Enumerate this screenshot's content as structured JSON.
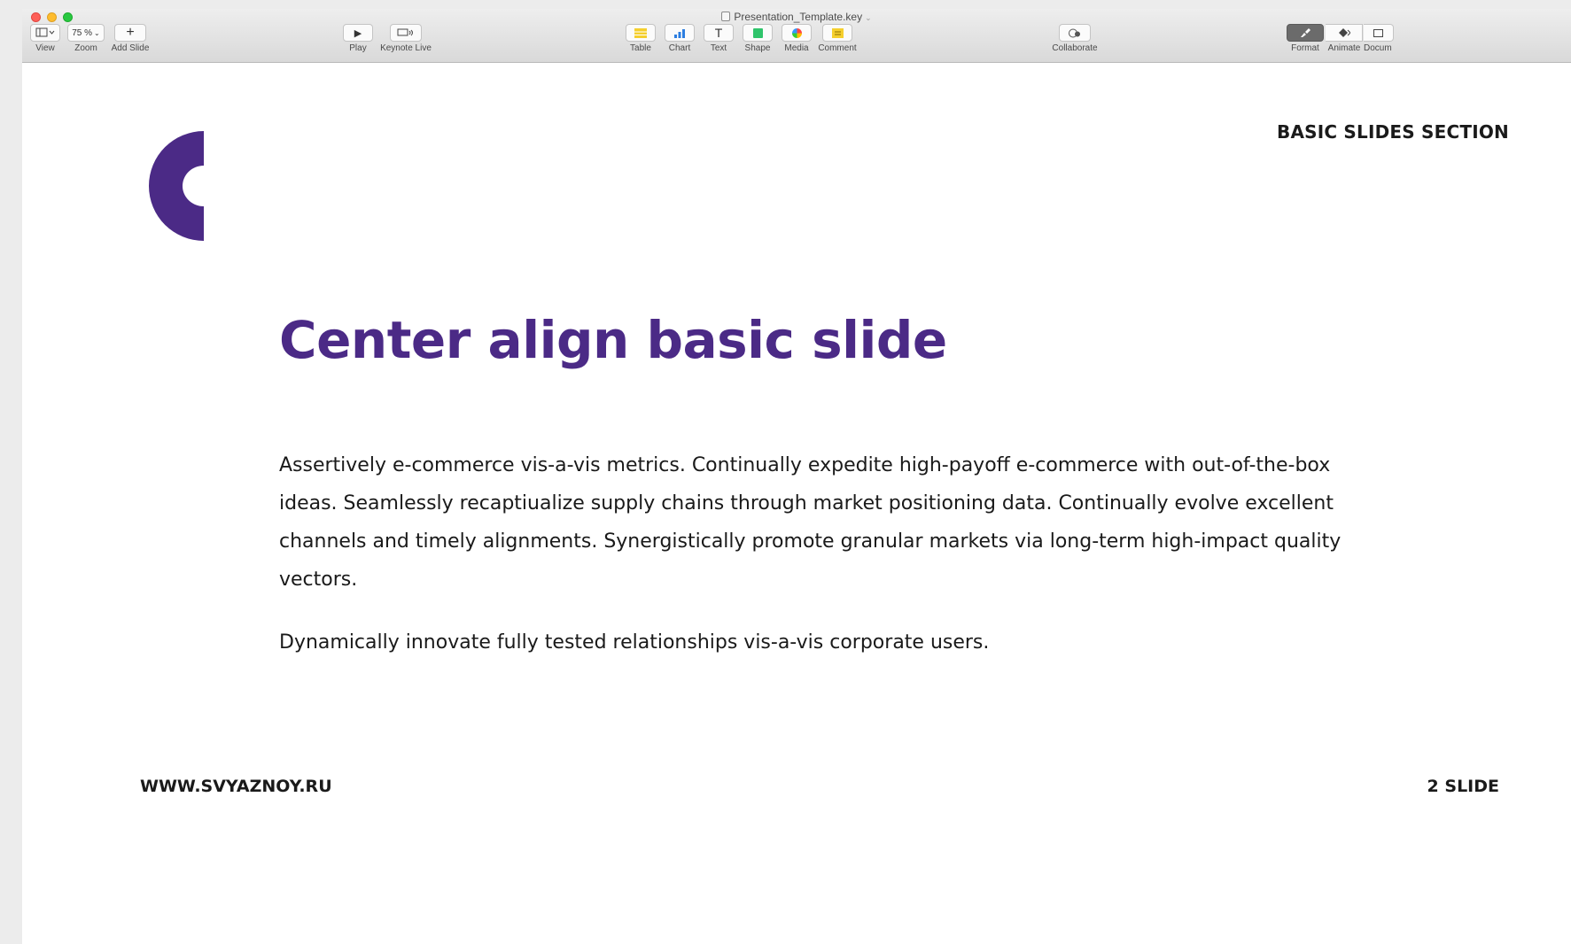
{
  "window": {
    "title": "Presentation_Template.key"
  },
  "toolbar": {
    "view": {
      "label": "View"
    },
    "zoom": {
      "label": "Zoom",
      "value": "75 %"
    },
    "add_slide": {
      "label": "Add Slide"
    },
    "play": {
      "label": "Play"
    },
    "keynote_live": {
      "label": "Keynote Live"
    },
    "table": {
      "label": "Table"
    },
    "chart": {
      "label": "Chart"
    },
    "text": {
      "label": "Text"
    },
    "shape": {
      "label": "Shape"
    },
    "media": {
      "label": "Media"
    },
    "comment": {
      "label": "Comment"
    },
    "collaborate": {
      "label": "Collaborate"
    },
    "format": {
      "label": "Format"
    },
    "animate": {
      "label": "Animate"
    },
    "document": {
      "label": "Docum"
    }
  },
  "slide": {
    "section_label": "BASIC SLIDES SECTION",
    "title": "Center align basic slide",
    "paragraphs": [
      "Assertively e-commerce vis-a-vis metrics. Continually expedite high-payoff e-commerce with out-of-the-box ideas. Seamlessly recaptiualize supply chains through market positioning data. Continually evolve excellent channels and timely alignments. Synergistically promote granular markets via long-term high-impact quality vectors.",
      "Dynamically innovate fully tested relationships vis-a-vis corporate users."
    ],
    "footer_left": "WWW.SVYAZNOY.RU",
    "footer_right": "2 SLIDE"
  },
  "colors": {
    "accent": "#4b2a86",
    "text": "#1a1a1a"
  }
}
